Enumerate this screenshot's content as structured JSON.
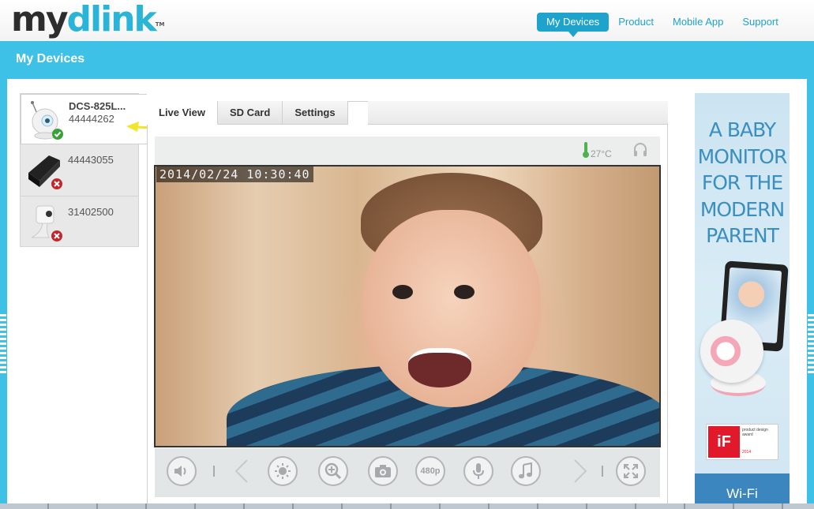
{
  "brand": {
    "logo_my": "my",
    "logo_dlink": "dlink",
    "logo_tm": "TM"
  },
  "nav": {
    "items": [
      {
        "label": "My Devices",
        "active": true
      },
      {
        "label": "Product",
        "active": false
      },
      {
        "label": "Mobile App",
        "active": false
      },
      {
        "label": "Support",
        "active": false
      }
    ]
  },
  "page": {
    "title": "My Devices"
  },
  "devices": [
    {
      "name": "DCS-825L...",
      "id": "44444262",
      "status": "online",
      "icon": "baby-camera-icon"
    },
    {
      "name": "",
      "id": "44443055",
      "status": "offline",
      "icon": "router-icon"
    },
    {
      "name": "",
      "id": "31402500",
      "status": "offline",
      "icon": "cube-camera-icon"
    }
  ],
  "tabs": [
    {
      "label": "Live View",
      "active": true
    },
    {
      "label": "SD Card",
      "active": false
    },
    {
      "label": "Settings",
      "active": false
    }
  ],
  "status": {
    "temperature": "27°C"
  },
  "video": {
    "timestamp": "2014/02/24 10:30:40"
  },
  "controls": {
    "resolution_label": "480p",
    "icons": [
      "speaker-icon",
      "chevron-left-icon",
      "brightness-icon",
      "zoom-icon",
      "snapshot-icon",
      "resolution-480p-button",
      "microphone-icon",
      "music-icon",
      "chevron-right-icon",
      "fullscreen-icon"
    ]
  },
  "ad": {
    "headline_lines": [
      "A BABY",
      "MONITOR",
      "FOR THE",
      "MODERN",
      "PARENT"
    ],
    "award_line1": "product design award",
    "award_year": "2014",
    "award_logo": "iF",
    "footer": "Wi-Fi"
  },
  "colors": {
    "accent": "#1ea3cc",
    "band": "#3ec1e6",
    "online": "#3aa13a",
    "offline": "#c0272d"
  }
}
